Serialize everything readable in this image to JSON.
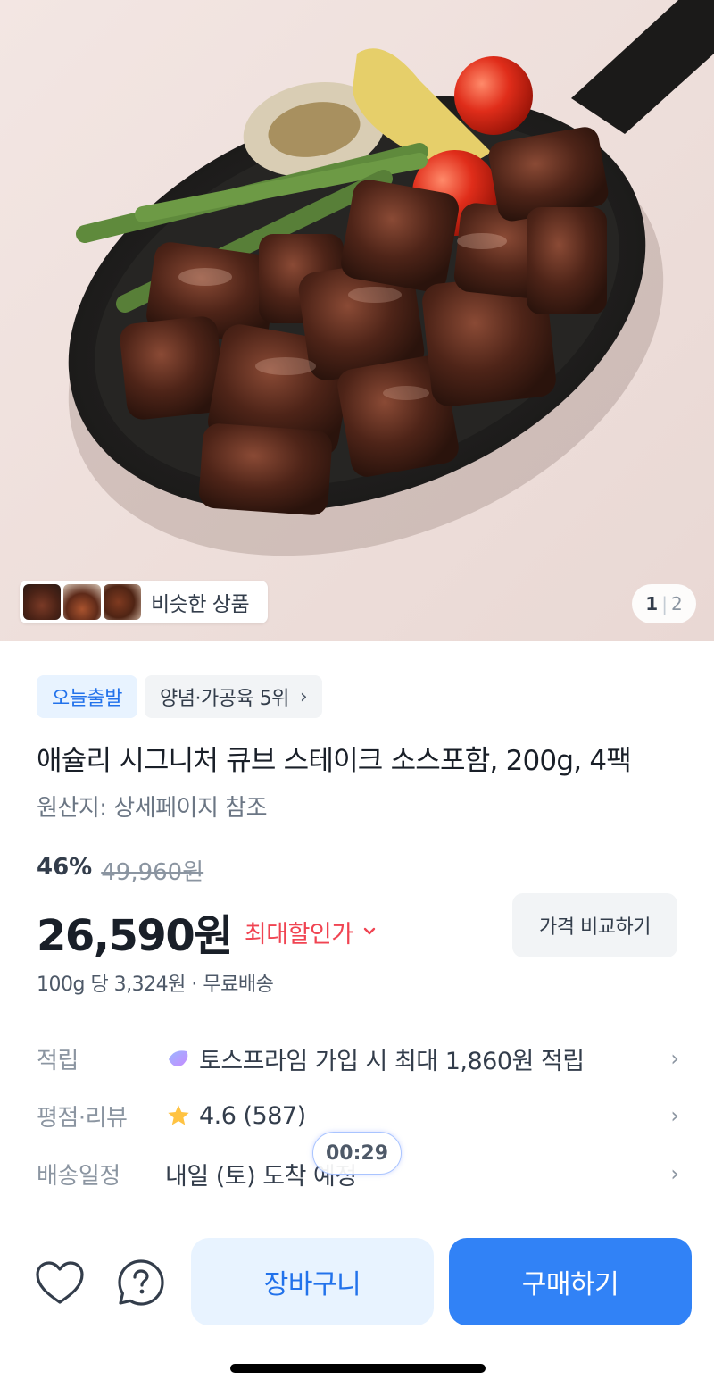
{
  "hero": {
    "similar_label": "비슷한 상품",
    "pager_current": "1",
    "pager_total": "2",
    "pager_sep": "|"
  },
  "tags": {
    "delivery": "오늘출발",
    "ranking": "양념·가공육 5위",
    "ranking_chevron": "›"
  },
  "product": {
    "title": "애슐리 시그니처 큐브 스테이크 소스포함, 200g, 4팩",
    "origin": "원산지: 상세페이지 참조",
    "discount_pct": "46%",
    "original_price": "49,960원",
    "price": "26,590원",
    "max_discount_label": "최대할인가",
    "max_discount_chevron": "⌄",
    "compare_label": "가격 비교하기",
    "unit_info": "100g 당 3,324원 · 무료배송"
  },
  "info": {
    "points_key": "적립",
    "points_value": "토스프라임 가입 시 최대 1,860원 적립",
    "rating_key": "평점·리뷰",
    "rating_value": "4.6 (587)",
    "delivery_key": "배송일정",
    "delivery_value": "내일 (토) 도착 예정",
    "chevron": "›"
  },
  "timer": {
    "value": "00:29"
  },
  "bottom": {
    "cart_label": "장바구니",
    "buy_label": "구매하기"
  },
  "colors": {
    "primary": "#3182f6",
    "primary_light": "#e8f3ff",
    "discount_red": "#f04452",
    "star": "#ffc342"
  }
}
